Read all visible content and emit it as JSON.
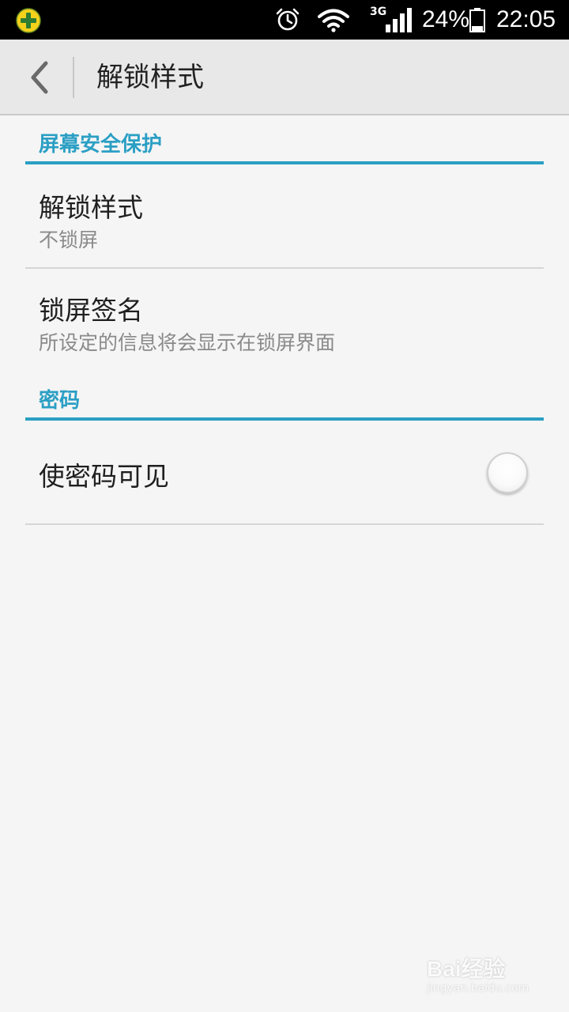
{
  "status_bar": {
    "network_label": "3G",
    "battery_text": "24%",
    "time": "22:05",
    "battery_level": 0.24,
    "icons": [
      "app-plus-icon",
      "alarm-icon",
      "wifi-icon",
      "signal-icon",
      "battery-icon"
    ]
  },
  "title_bar": {
    "title": "解锁样式",
    "back_icon": "chevron-left-icon"
  },
  "sections": {
    "screen_security": {
      "header": "屏幕安全保护",
      "unlock_style": {
        "title": "解锁样式",
        "subtitle": "不锁屏"
      },
      "lock_signature": {
        "title": "锁屏签名",
        "subtitle": "所设定的信息将会显示在锁屏界面"
      }
    },
    "password": {
      "header": "密码",
      "show_password": {
        "title": "使密码可见",
        "enabled": false
      }
    }
  },
  "watermark": {
    "brand": "Bai经验",
    "url": "jingyan.baidu.com"
  },
  "colors": {
    "accent": "#2b9fc4",
    "background": "#f5f5f5",
    "titlebar": "#e8e8e8",
    "status_bar": "#000000"
  }
}
